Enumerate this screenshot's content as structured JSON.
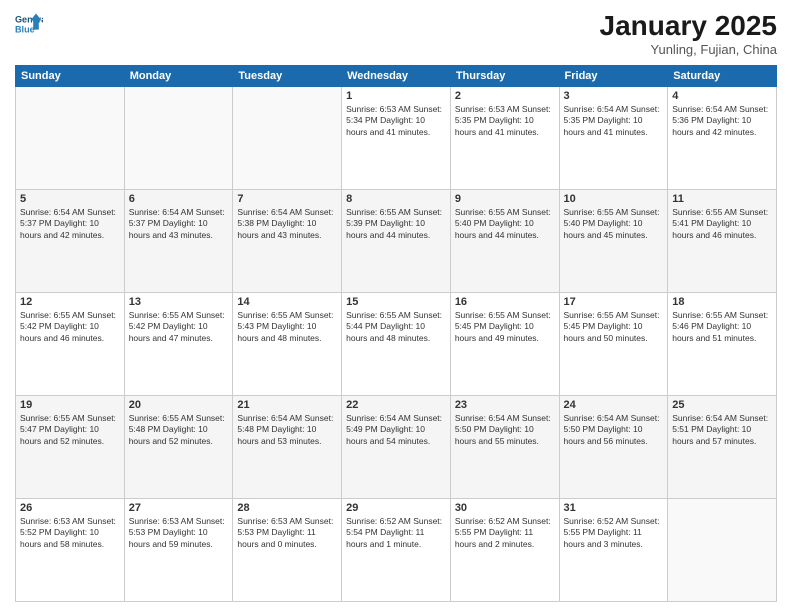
{
  "header": {
    "title": "January 2025",
    "subtitle": "Yunling, Fujian, China"
  },
  "calendar": {
    "days": [
      "Sunday",
      "Monday",
      "Tuesday",
      "Wednesday",
      "Thursday",
      "Friday",
      "Saturday"
    ]
  },
  "weeks": [
    [
      {
        "day": "",
        "text": ""
      },
      {
        "day": "",
        "text": ""
      },
      {
        "day": "",
        "text": ""
      },
      {
        "day": "1",
        "text": "Sunrise: 6:53 AM\nSunset: 5:34 PM\nDaylight: 10 hours\nand 41 minutes."
      },
      {
        "day": "2",
        "text": "Sunrise: 6:53 AM\nSunset: 5:35 PM\nDaylight: 10 hours\nand 41 minutes."
      },
      {
        "day": "3",
        "text": "Sunrise: 6:54 AM\nSunset: 5:35 PM\nDaylight: 10 hours\nand 41 minutes."
      },
      {
        "day": "4",
        "text": "Sunrise: 6:54 AM\nSunset: 5:36 PM\nDaylight: 10 hours\nand 42 minutes."
      }
    ],
    [
      {
        "day": "5",
        "text": "Sunrise: 6:54 AM\nSunset: 5:37 PM\nDaylight: 10 hours\nand 42 minutes."
      },
      {
        "day": "6",
        "text": "Sunrise: 6:54 AM\nSunset: 5:37 PM\nDaylight: 10 hours\nand 43 minutes."
      },
      {
        "day": "7",
        "text": "Sunrise: 6:54 AM\nSunset: 5:38 PM\nDaylight: 10 hours\nand 43 minutes."
      },
      {
        "day": "8",
        "text": "Sunrise: 6:55 AM\nSunset: 5:39 PM\nDaylight: 10 hours\nand 44 minutes."
      },
      {
        "day": "9",
        "text": "Sunrise: 6:55 AM\nSunset: 5:40 PM\nDaylight: 10 hours\nand 44 minutes."
      },
      {
        "day": "10",
        "text": "Sunrise: 6:55 AM\nSunset: 5:40 PM\nDaylight: 10 hours\nand 45 minutes."
      },
      {
        "day": "11",
        "text": "Sunrise: 6:55 AM\nSunset: 5:41 PM\nDaylight: 10 hours\nand 46 minutes."
      }
    ],
    [
      {
        "day": "12",
        "text": "Sunrise: 6:55 AM\nSunset: 5:42 PM\nDaylight: 10 hours\nand 46 minutes."
      },
      {
        "day": "13",
        "text": "Sunrise: 6:55 AM\nSunset: 5:42 PM\nDaylight: 10 hours\nand 47 minutes."
      },
      {
        "day": "14",
        "text": "Sunrise: 6:55 AM\nSunset: 5:43 PM\nDaylight: 10 hours\nand 48 minutes."
      },
      {
        "day": "15",
        "text": "Sunrise: 6:55 AM\nSunset: 5:44 PM\nDaylight: 10 hours\nand 48 minutes."
      },
      {
        "day": "16",
        "text": "Sunrise: 6:55 AM\nSunset: 5:45 PM\nDaylight: 10 hours\nand 49 minutes."
      },
      {
        "day": "17",
        "text": "Sunrise: 6:55 AM\nSunset: 5:45 PM\nDaylight: 10 hours\nand 50 minutes."
      },
      {
        "day": "18",
        "text": "Sunrise: 6:55 AM\nSunset: 5:46 PM\nDaylight: 10 hours\nand 51 minutes."
      }
    ],
    [
      {
        "day": "19",
        "text": "Sunrise: 6:55 AM\nSunset: 5:47 PM\nDaylight: 10 hours\nand 52 minutes."
      },
      {
        "day": "20",
        "text": "Sunrise: 6:55 AM\nSunset: 5:48 PM\nDaylight: 10 hours\nand 52 minutes."
      },
      {
        "day": "21",
        "text": "Sunrise: 6:54 AM\nSunset: 5:48 PM\nDaylight: 10 hours\nand 53 minutes."
      },
      {
        "day": "22",
        "text": "Sunrise: 6:54 AM\nSunset: 5:49 PM\nDaylight: 10 hours\nand 54 minutes."
      },
      {
        "day": "23",
        "text": "Sunrise: 6:54 AM\nSunset: 5:50 PM\nDaylight: 10 hours\nand 55 minutes."
      },
      {
        "day": "24",
        "text": "Sunrise: 6:54 AM\nSunset: 5:50 PM\nDaylight: 10 hours\nand 56 minutes."
      },
      {
        "day": "25",
        "text": "Sunrise: 6:54 AM\nSunset: 5:51 PM\nDaylight: 10 hours\nand 57 minutes."
      }
    ],
    [
      {
        "day": "26",
        "text": "Sunrise: 6:53 AM\nSunset: 5:52 PM\nDaylight: 10 hours\nand 58 minutes."
      },
      {
        "day": "27",
        "text": "Sunrise: 6:53 AM\nSunset: 5:53 PM\nDaylight: 10 hours\nand 59 minutes."
      },
      {
        "day": "28",
        "text": "Sunrise: 6:53 AM\nSunset: 5:53 PM\nDaylight: 11 hours\nand 0 minutes."
      },
      {
        "day": "29",
        "text": "Sunrise: 6:52 AM\nSunset: 5:54 PM\nDaylight: 11 hours\nand 1 minute."
      },
      {
        "day": "30",
        "text": "Sunrise: 6:52 AM\nSunset: 5:55 PM\nDaylight: 11 hours\nand 2 minutes."
      },
      {
        "day": "31",
        "text": "Sunrise: 6:52 AM\nSunset: 5:55 PM\nDaylight: 11 hours\nand 3 minutes."
      },
      {
        "day": "",
        "text": ""
      }
    ]
  ]
}
